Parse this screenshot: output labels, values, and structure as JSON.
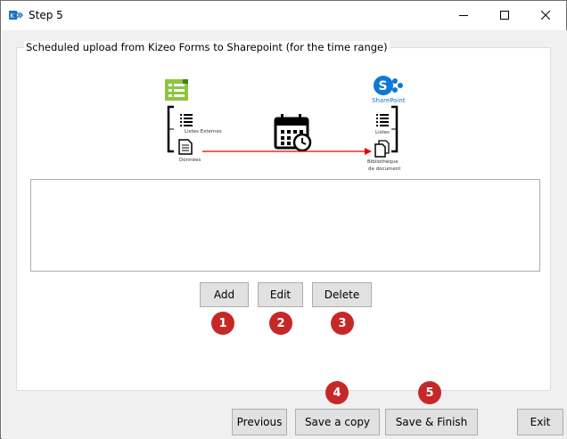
{
  "window": {
    "title": "Step 5"
  },
  "group": {
    "title": "Scheduled upload from Kizeo Forms to Sharepoint (for the time range)"
  },
  "diagram": {
    "left_items": [
      {
        "label": "Listes Externes",
        "icon": "list-icon"
      },
      {
        "label": "Données",
        "icon": "document-icon"
      }
    ],
    "right_title": "SharePoint",
    "right_items": [
      {
        "label": "Listes",
        "icon": "list-icon"
      },
      {
        "label_line1": "Bibliothèque",
        "label_line2": "de document",
        "icon": "documents-icon"
      }
    ],
    "colors": {
      "kizeo_green": "#8dc63f",
      "sharepoint_blue": "#0f78d4",
      "arrow_red": "#e00000"
    }
  },
  "buttons": {
    "add": "Add",
    "edit": "Edit",
    "delete": "Delete",
    "previous": "Previous",
    "save_copy": "Save a copy",
    "save_finish": "Save & Finish",
    "exit": "Exit"
  },
  "badges": [
    "1",
    "2",
    "3",
    "4",
    "5"
  ],
  "colors": {
    "badge": "#c62828",
    "button_bg": "#e1e1e1"
  }
}
